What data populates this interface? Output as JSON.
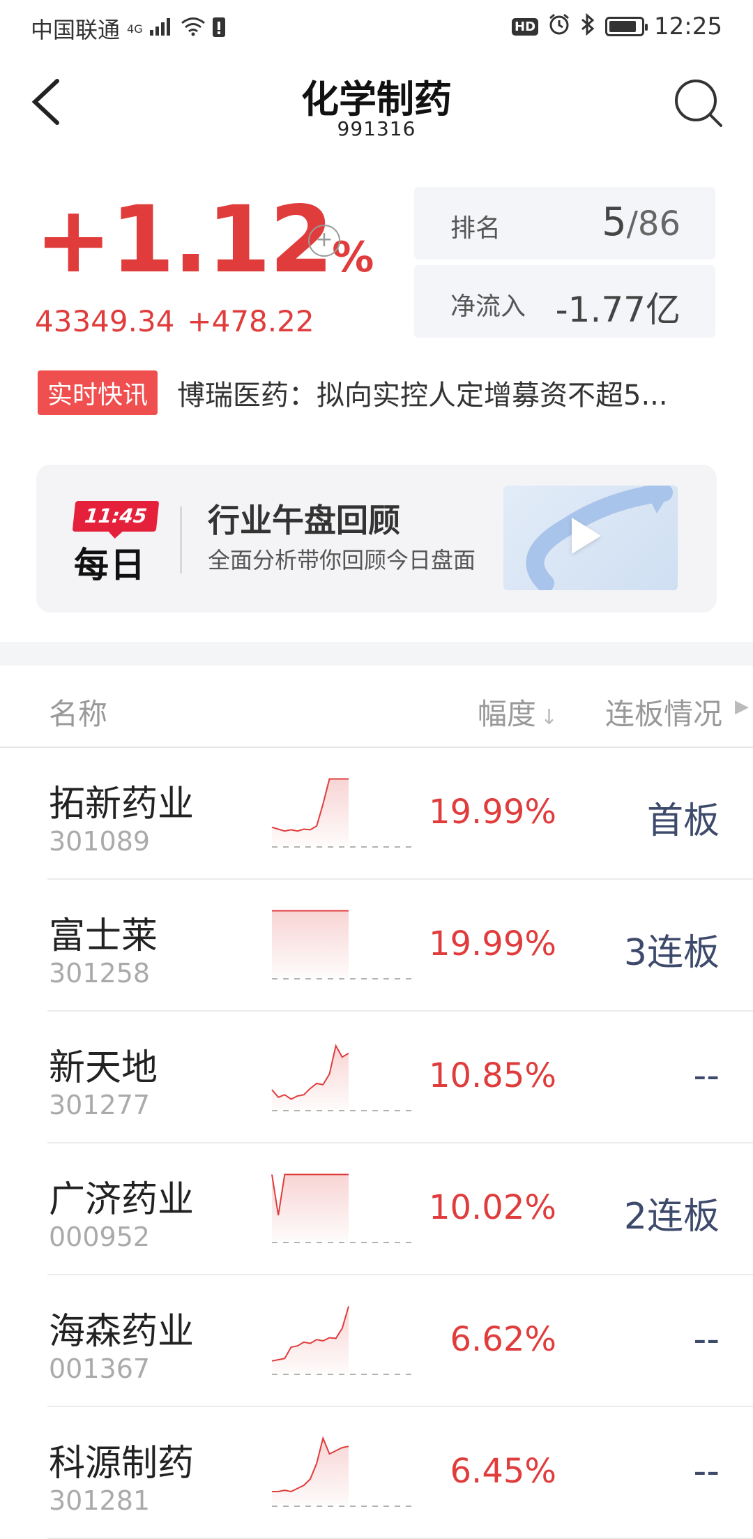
{
  "status_bar": {
    "carrier": "中国联通",
    "network": "4G",
    "time": "12:25",
    "battery_level": 0.75
  },
  "header": {
    "title": "化学制药",
    "code": "991316"
  },
  "quote": {
    "change_pct": "+1.12",
    "pct_unit": "%",
    "index_value": "43349.34",
    "change_value": "+478.22",
    "add_symbol": "+"
  },
  "stats": {
    "rank_label": "排名",
    "rank_value": "5",
    "rank_total": "/86",
    "inflow_label": "净流入",
    "inflow_value": "-1.77亿"
  },
  "news": {
    "badge": "实时快讯",
    "text": "博瑞医药：拟向实控人定增募资不超5..."
  },
  "daily": {
    "time": "11:45",
    "word": "每日",
    "title": "行业午盘回顾",
    "subtitle": "全面分析带你回顾今日盘面"
  },
  "table": {
    "col_name": "名称",
    "col_range": "幅度",
    "col_streak": "连板情况",
    "rows": [
      {
        "name": "拓新药业",
        "code": "301089",
        "pct": "19.99%",
        "streak": "首板",
        "spark": [
          0.18,
          0.15,
          0.12,
          0.14,
          0.12,
          0.15,
          0.14,
          0.2,
          0.55,
          0.95,
          0.95,
          0.95,
          0.95
        ]
      },
      {
        "name": "富士莱",
        "code": "301258",
        "pct": "19.99%",
        "streak": "3连板",
        "spark": [
          0.95,
          0.95,
          0.95,
          0.95,
          0.95,
          0.95,
          0.95,
          0.95,
          0.95,
          0.95,
          0.95,
          0.95,
          0.95
        ]
      },
      {
        "name": "新天地",
        "code": "301277",
        "pct": "10.85%",
        "streak": "--",
        "spark": [
          0.2,
          0.08,
          0.12,
          0.05,
          0.1,
          0.12,
          0.22,
          0.3,
          0.28,
          0.45,
          0.9,
          0.72,
          0.78
        ]
      },
      {
        "name": "广济药业",
        "code": "000952",
        "pct": "10.02%",
        "streak": "2连板",
        "spark": [
          0.95,
          0.3,
          0.95,
          0.95,
          0.95,
          0.95,
          0.95,
          0.95,
          0.95,
          0.95,
          0.95,
          0.95,
          0.95
        ]
      },
      {
        "name": "海森药业",
        "code": "001367",
        "pct": "6.62%",
        "streak": "--",
        "spark": [
          0.08,
          0.1,
          0.12,
          0.3,
          0.32,
          0.38,
          0.36,
          0.42,
          0.4,
          0.45,
          0.44,
          0.6,
          0.95
        ]
      },
      {
        "name": "科源制药",
        "code": "301281",
        "pct": "6.45%",
        "streak": "--",
        "spark": [
          0.1,
          0.1,
          0.12,
          0.1,
          0.15,
          0.2,
          0.3,
          0.55,
          0.95,
          0.7,
          0.75,
          0.8,
          0.82
        ]
      }
    ]
  },
  "colors": {
    "up_red": "#e03c3c",
    "badge_red": "#ef4f4f",
    "streak_navy": "#3d4a6b"
  }
}
